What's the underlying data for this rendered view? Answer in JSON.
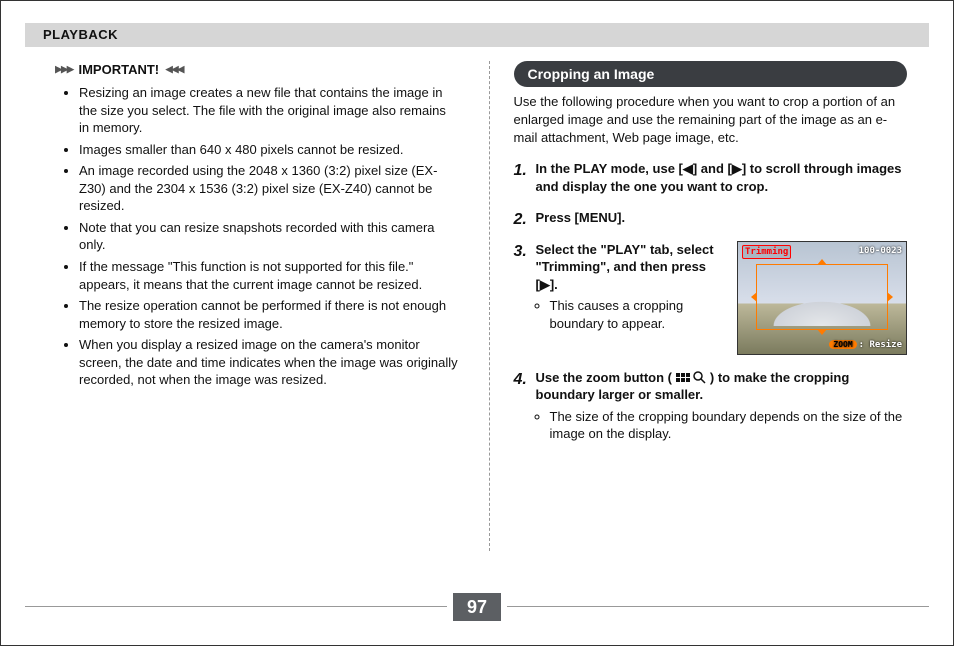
{
  "header": {
    "section": "PLAYBACK"
  },
  "left": {
    "important_label": "IMPORTANT!",
    "bullets": [
      "Resizing an image creates a new file that contains the image in the size you select. The file with the original image also remains in memory.",
      "Images smaller than 640 x 480 pixels cannot be resized.",
      "An image recorded using the 2048 x 1360 (3:2) pixel size (EX-Z30) and the 2304 x 1536 (3:2) pixel size (EX-Z40) cannot be resized.",
      "Note that you can resize snapshots recorded with this camera only.",
      "If the message \"This function is not supported for this file.\" appears, it means that the current image cannot be resized.",
      "The resize operation cannot be performed if there is not enough memory to store the resized image.",
      "When you display a resized image on the camera's monitor screen, the date and time indicates when the image was originally recorded, not when the image was resized."
    ]
  },
  "right": {
    "title": "Cropping an Image",
    "lead": "Use the following procedure when you want to crop a portion of an enlarged image and use the remaining part of the image as an e-mail attachment, Web page image, etc.",
    "steps": {
      "s1": "In the PLAY mode, use [◀] and [▶] to scroll through images and display the one you want to crop.",
      "s2": "Press [MENU].",
      "s3": "Select the \"PLAY\" tab, select \"Trimming\", and then press [▶].",
      "s3_sub": "This causes a cropping boundary to appear.",
      "s4_pre": "Use the zoom button (",
      "s4_post": ") to make the cropping boundary larger or smaller.",
      "s4_sub": "The size of the cropping boundary depends on the size of the image on the display."
    },
    "screenshot": {
      "trimming_label": "Trimming",
      "file_number": "100-0023",
      "zoom_tag": "ZOOM",
      "zoom_action": ": Resize"
    }
  },
  "footer": {
    "page_number": "97"
  }
}
